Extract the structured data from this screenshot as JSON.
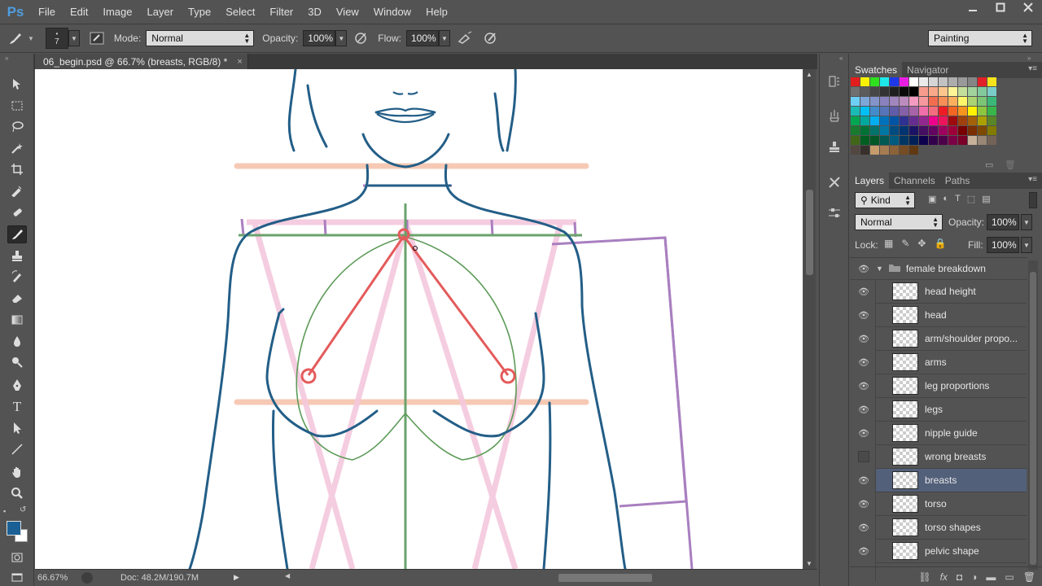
{
  "app": {
    "logo": "Ps"
  },
  "menu": [
    "File",
    "Edit",
    "Image",
    "Layer",
    "Type",
    "Select",
    "Filter",
    "3D",
    "View",
    "Window",
    "Help"
  ],
  "options": {
    "brush_size": "7",
    "mode_label": "Mode:",
    "mode_value": "Normal",
    "opacity_label": "Opacity:",
    "opacity_value": "100%",
    "flow_label": "Flow:",
    "flow_value": "100%",
    "workspace": "Painting"
  },
  "document": {
    "tab_title": "06_begin.psd @ 66.7% (breasts, RGB/8) *",
    "close_glyph": "×"
  },
  "status": {
    "zoom": "66.67%",
    "doc_size": "Doc: 48.2M/190.7M"
  },
  "colors": {
    "foreground": "#1b6095",
    "background": "#ffffff",
    "layer_selected": "#52607a"
  },
  "panels": {
    "swatches_tab": "Swatches",
    "navigator_tab": "Navigator",
    "layers_tab": "Layers",
    "channels_tab": "Channels",
    "paths_tab": "Paths",
    "filter_kind": "Kind",
    "blend_mode": "Normal",
    "opacity_label": "Opacity:",
    "opacity_value": "100%",
    "lock_label": "Lock:",
    "fill_label": "Fill:",
    "fill_value": "100%"
  },
  "layers": {
    "group": "female breakdown",
    "items": [
      {
        "name": "head height",
        "visible": true
      },
      {
        "name": "head",
        "visible": true
      },
      {
        "name": "arm/shoulder propo...",
        "visible": true
      },
      {
        "name": "arms",
        "visible": true
      },
      {
        "name": "leg proportions",
        "visible": true
      },
      {
        "name": "legs",
        "visible": true
      },
      {
        "name": "nipple guide",
        "visible": true
      },
      {
        "name": "wrong breasts",
        "visible": false
      },
      {
        "name": "breasts",
        "visible": true,
        "selected": true
      },
      {
        "name": "torso",
        "visible": true
      },
      {
        "name": "torso shapes",
        "visible": true
      },
      {
        "name": "pelvic shape",
        "visible": true
      }
    ]
  }
}
